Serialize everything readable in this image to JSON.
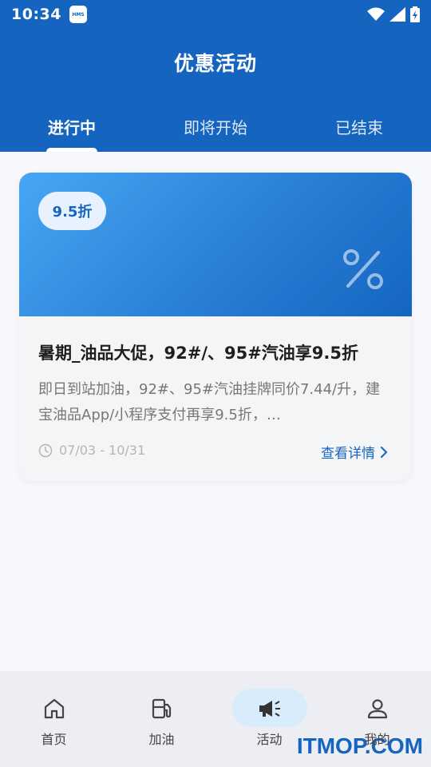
{
  "status_bar": {
    "time": "10:34",
    "hms_label": "HMS"
  },
  "header": {
    "title": "优惠活动"
  },
  "tabs": [
    {
      "label": "进行中",
      "active": true
    },
    {
      "label": "即将开始",
      "active": false
    },
    {
      "label": "已结束",
      "active": false
    }
  ],
  "card": {
    "badge": "9.5折",
    "title": "暑期_油品大促，92#/、95#汽油享9.5折",
    "description": "即日到站加油，92#、95#汽油挂牌同价7.44/升，建宝油品App/小程序支付再享9.5折，…",
    "date_range": "07/03 - 10/31",
    "detail_link": "查看详情"
  },
  "bottom_nav": [
    {
      "label": "首页",
      "icon": "home-icon",
      "active": false
    },
    {
      "label": "加油",
      "icon": "fuel-pump-icon",
      "active": false
    },
    {
      "label": "活动",
      "icon": "megaphone-icon",
      "active": true
    },
    {
      "label": "我的",
      "icon": "person-icon",
      "active": false
    }
  ],
  "watermark": "ITMOP.COM",
  "colors": {
    "primary": "#1565c0",
    "background": "#f7f8fc",
    "nav_active_pill": "#d9ecfb"
  }
}
